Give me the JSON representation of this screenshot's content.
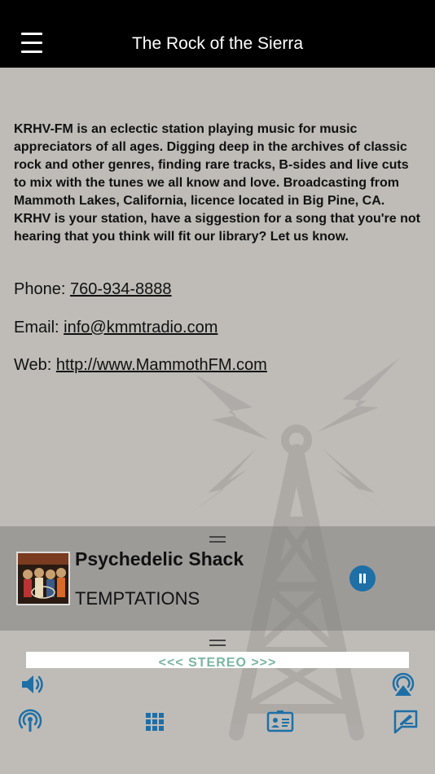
{
  "header": {
    "title": "The Rock of the Sierra",
    "menu_icon": "hamburger-menu-icon"
  },
  "about": {
    "description": "KRHV-FM is an eclectic station playing music for music appreciators of all ages. Digging deep in the archives of classic rock and other genres, finding rare tracks, B-sides and live cuts to mix with the tunes we all know and love. Broadcasting from Mammoth Lakes, California, licence located in Big Pine, CA. KRHV is your station, have a siggestion for a song that you're not hearing that you think will fit our library? Let us know."
  },
  "contact": {
    "phone_label": "Phone:",
    "phone": "760-934-8888",
    "email_label": "Email:",
    "email": "info@kmmtradio.com",
    "web_label": "Web:",
    "web": "http://www.MammothFM.com"
  },
  "player": {
    "song": "Psychedelic Shack",
    "artist": "TEMPTATIONS",
    "state": "playing",
    "control_icon": "pause-icon"
  },
  "banner": {
    "text": "<<< STEREO >>>"
  },
  "toolbar": {
    "icons": [
      "volume-icon",
      "airplay-icon",
      "broadcast-icon",
      "grid-menu-icon",
      "contact-card-icon",
      "message-edit-icon"
    ]
  },
  "colors": {
    "accent": "#1e6fa6",
    "header_bg": "#000000",
    "background": "#bfbcb8"
  }
}
